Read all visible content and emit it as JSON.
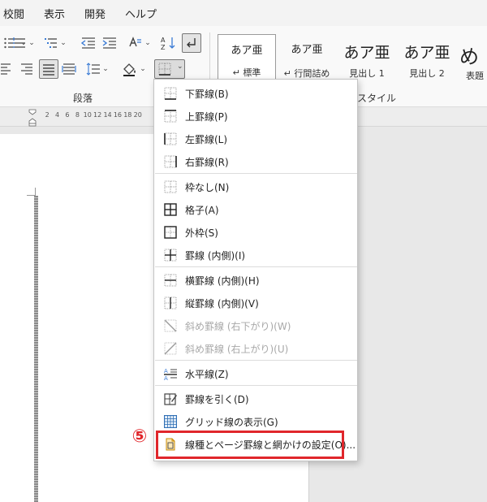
{
  "menubar": {
    "items": [
      "校閲",
      "表示",
      "開発",
      "ヘルプ"
    ]
  },
  "ribbon": {
    "paragraph_group_label": "段落",
    "styles_group_label": "スタイル",
    "styles": [
      {
        "sample": "あア亜",
        "name": "標準",
        "prefix": "↵",
        "selected": true
      },
      {
        "sample": "あア亜",
        "name": "行間詰め",
        "prefix": "↵",
        "selected": false
      },
      {
        "sample": "あア亜",
        "name": "見出し 1",
        "prefix": "",
        "selected": false
      },
      {
        "sample": "あア亜",
        "name": "見出し 2",
        "prefix": "",
        "selected": false
      },
      {
        "sample": "め",
        "name": "表題",
        "prefix": "",
        "selected": false
      }
    ]
  },
  "ruler": {
    "numbers": [
      "2",
      "4",
      "6",
      "8",
      "10",
      "12",
      "14",
      "16",
      "18",
      "20"
    ]
  },
  "border_menu": {
    "items": [
      {
        "label": "下罫線(B)",
        "icon": "border-bottom-icon",
        "disabled": false
      },
      {
        "label": "上罫線(P)",
        "icon": "border-top-icon",
        "disabled": false
      },
      {
        "label": "左罫線(L)",
        "icon": "border-left-icon",
        "disabled": false
      },
      {
        "label": "右罫線(R)",
        "icon": "border-right-icon",
        "disabled": false
      },
      {
        "label": "枠なし(N)",
        "icon": "border-none-icon",
        "disabled": false
      },
      {
        "label": "格子(A)",
        "icon": "border-all-icon",
        "disabled": false
      },
      {
        "label": "外枠(S)",
        "icon": "border-outside-icon",
        "disabled": false
      },
      {
        "label": "罫線 (内側)(I)",
        "icon": "border-inside-icon",
        "disabled": false
      },
      {
        "label": "横罫線 (内側)(H)",
        "icon": "border-inside-horizontal-icon",
        "disabled": false
      },
      {
        "label": "縦罫線 (内側)(V)",
        "icon": "border-inside-vertical-icon",
        "disabled": false
      },
      {
        "label": "斜め罫線 (右下がり)(W)",
        "icon": "diagonal-down-border-icon",
        "disabled": true
      },
      {
        "label": "斜め罫線 (右上がり)(U)",
        "icon": "diagonal-up-border-icon",
        "disabled": true
      },
      {
        "label": "水平線(Z)",
        "icon": "horizontal-line-icon",
        "disabled": false
      },
      {
        "label": "罫線を引く(D)",
        "icon": "draw-table-icon",
        "disabled": false
      },
      {
        "label": "グリッド線の表示(G)",
        "icon": "view-gridlines-icon",
        "disabled": false
      },
      {
        "label": "線種とページ罫線と網かけの設定(O)...",
        "icon": "borders-shading-icon",
        "disabled": false
      }
    ]
  },
  "annotation": {
    "step_number": "⑤",
    "highlight_color": "#e0262b"
  }
}
